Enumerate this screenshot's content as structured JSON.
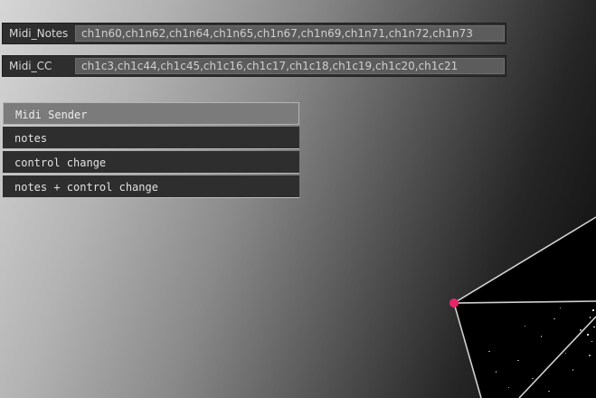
{
  "midi_notes": {
    "label": "Midi_Notes",
    "value": "ch1n60,ch1n62,ch1n64,ch1n65,ch1n67,ch1n69,ch1n71,ch1n72,ch1n73"
  },
  "midi_cc": {
    "label": "Midi_CC",
    "value": "ch1c3,ch1c44,ch1c45,ch1c16,ch1c17,ch1c18,ch1c19,ch1c20,ch1c21"
  },
  "menu": {
    "title": "Midi Sender",
    "items": [
      {
        "label": "notes"
      },
      {
        "label": "control change"
      },
      {
        "label": "notes + control change"
      }
    ]
  },
  "colors": {
    "panel": "#2e2e2e",
    "field": "#5c5c5c",
    "menu_header": "#7b7b7b",
    "vertex_handle": "#e8246a"
  }
}
